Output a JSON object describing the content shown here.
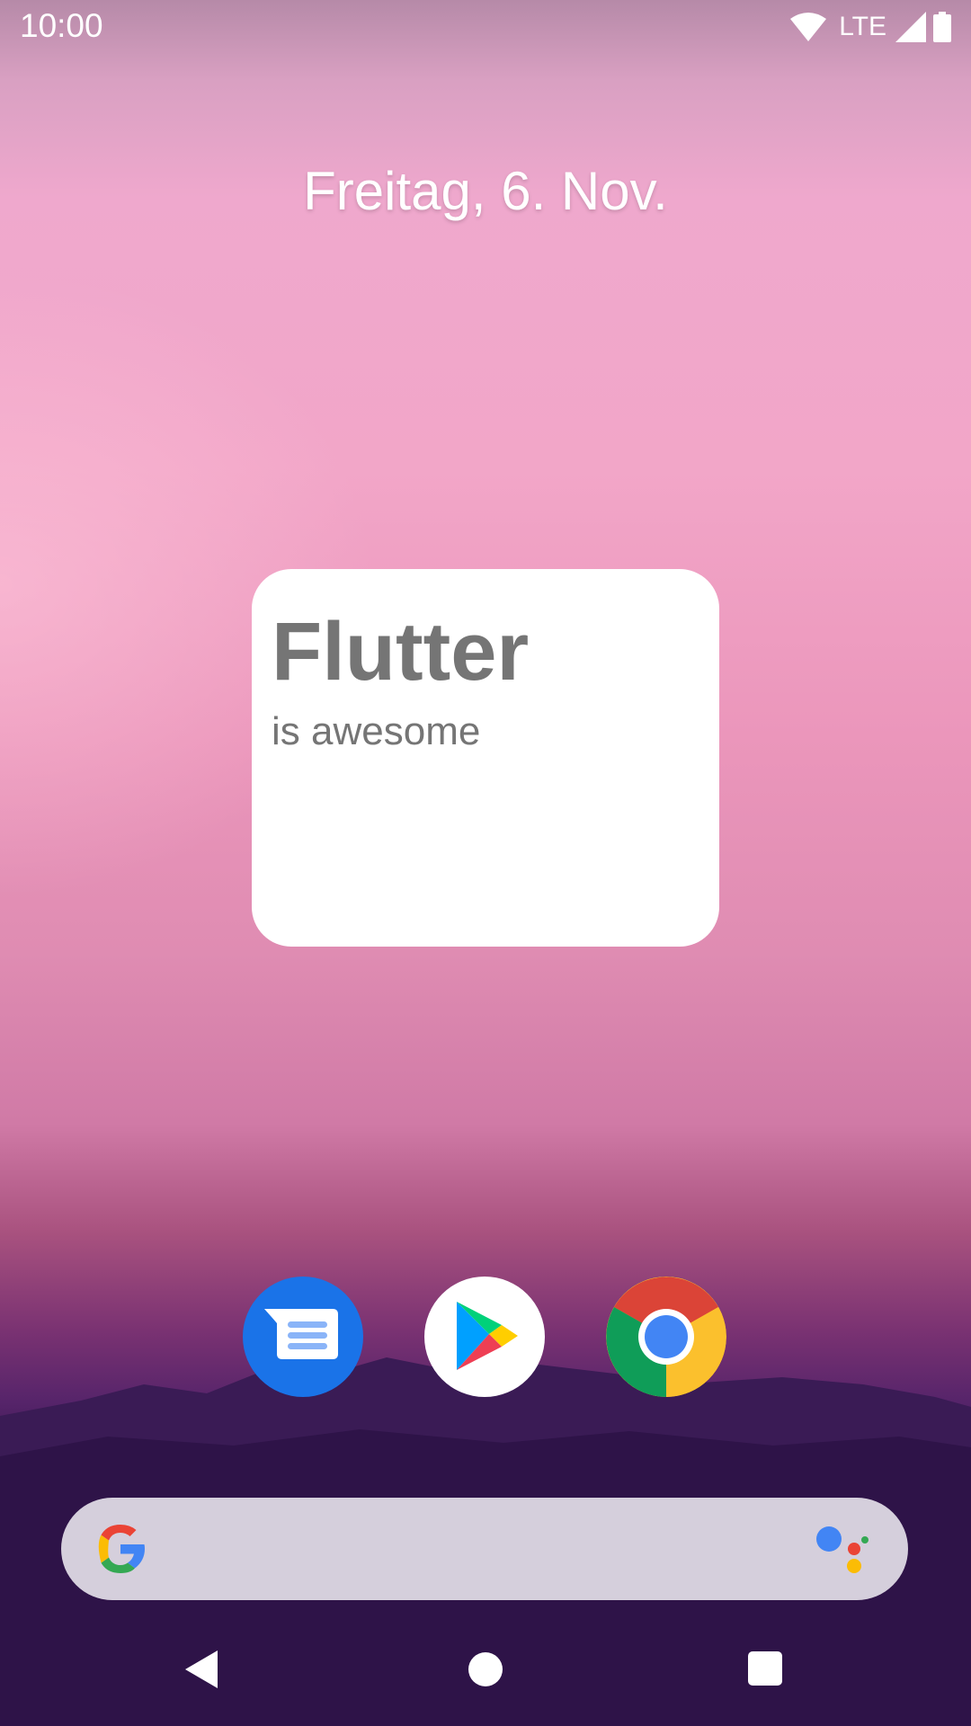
{
  "status_bar": {
    "time": "10:00",
    "network_label": "LTE",
    "icons": [
      "wifi-icon",
      "cell-signal-icon",
      "battery-icon"
    ]
  },
  "home": {
    "date": "Freitag, 6. Nov."
  },
  "widget": {
    "title": "Flutter",
    "subtitle": "is awesome"
  },
  "dock": {
    "apps": [
      {
        "icon": "messages-icon",
        "color": "#1a73e8"
      },
      {
        "icon": "play-store-icon",
        "color": "#ffffff"
      },
      {
        "icon": "chrome-icon",
        "color": "#4285f4"
      }
    ]
  },
  "search_bar": {
    "icons": [
      "google-g-icon",
      "assistant-icon"
    ],
    "background": "#d5cfdc"
  },
  "nav_bar": {
    "icons": [
      "back-icon",
      "home-icon",
      "recents-icon"
    ]
  }
}
